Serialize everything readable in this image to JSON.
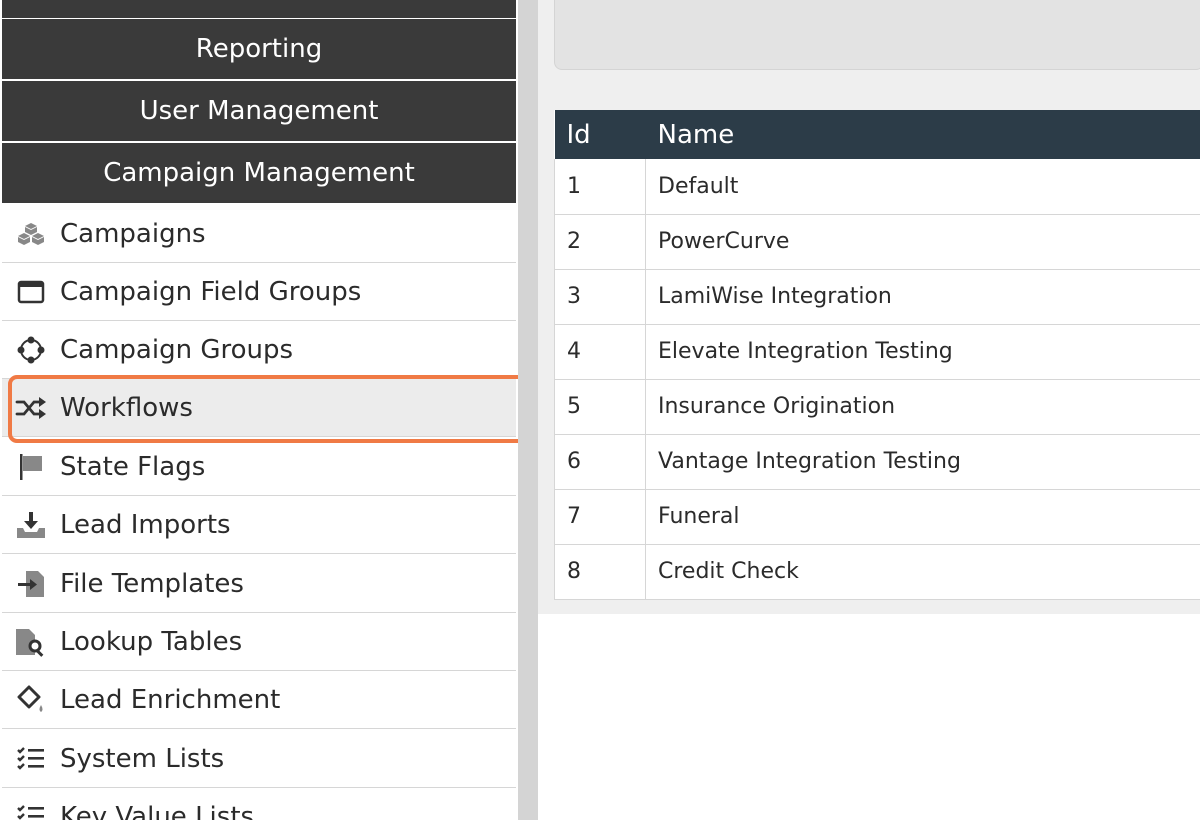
{
  "sidebar": {
    "headers": [
      "Reporting",
      "User Management",
      "Campaign Management"
    ],
    "items": [
      {
        "label": "Campaigns",
        "icon": "campaigns-icon"
      },
      {
        "label": "Campaign Field Groups",
        "icon": "window-icon"
      },
      {
        "label": "Campaign Groups",
        "icon": "group-nodes-icon"
      },
      {
        "label": "Workflows",
        "icon": "shuffle-icon",
        "active": true
      },
      {
        "label": "State Flags",
        "icon": "flag-icon"
      },
      {
        "label": "Lead Imports",
        "icon": "import-icon"
      },
      {
        "label": "File Templates",
        "icon": "file-import-icon"
      },
      {
        "label": "Lookup Tables",
        "icon": "file-search-icon"
      },
      {
        "label": "Lead Enrichment",
        "icon": "paint-bucket-icon"
      },
      {
        "label": "System Lists",
        "icon": "checklist-icon"
      },
      {
        "label": "Key Value Lists",
        "icon": "checklist-icon"
      }
    ]
  },
  "table": {
    "columns": [
      "Id",
      "Name"
    ],
    "rows": [
      {
        "id": "1",
        "name": "Default"
      },
      {
        "id": "2",
        "name": "PowerCurve"
      },
      {
        "id": "3",
        "name": "LamiWise Integration"
      },
      {
        "id": "4",
        "name": "Elevate Integration Testing"
      },
      {
        "id": "5",
        "name": "Insurance Origination"
      },
      {
        "id": "6",
        "name": "Vantage Integration Testing"
      },
      {
        "id": "7",
        "name": "Funeral"
      },
      {
        "id": "8",
        "name": "Credit Check"
      }
    ]
  },
  "colors": {
    "sidebar_header_bg": "#3a3a3a",
    "table_header_bg": "#2c3c48",
    "highlight": "#f07a45"
  }
}
